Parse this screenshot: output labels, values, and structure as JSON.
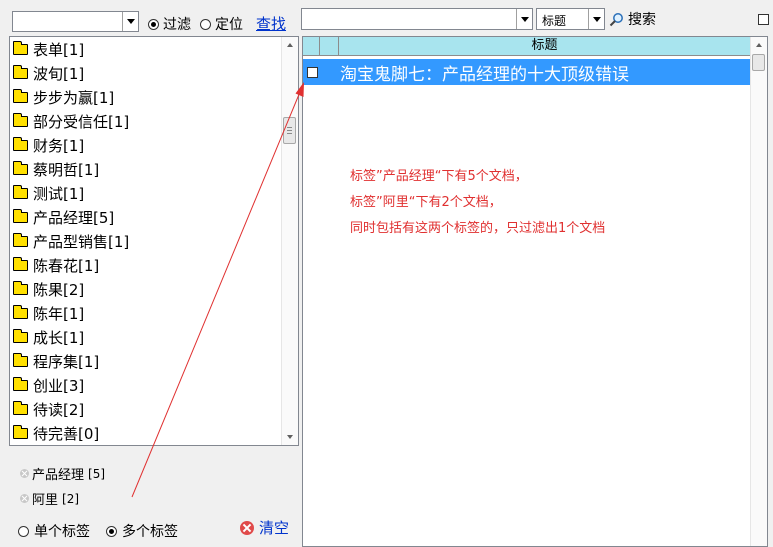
{
  "toolbar_left": {
    "filter_label": "过滤",
    "locate_label": "定位",
    "find_label": "查找",
    "mode_selected": "filter"
  },
  "toolbar_right": {
    "field_select": "标题",
    "search_label": "搜索"
  },
  "tag_tree": {
    "items": [
      {
        "label": "表单[1]"
      },
      {
        "label": "波旬[1]"
      },
      {
        "label": "步步为赢[1]"
      },
      {
        "label": "部分受信任[1]"
      },
      {
        "label": "财务[1]"
      },
      {
        "label": "蔡明哲[1]"
      },
      {
        "label": "测试[1]"
      },
      {
        "label": "产品经理[5]"
      },
      {
        "label": "产品型销售[1]"
      },
      {
        "label": "陈春花[1]"
      },
      {
        "label": "陈果[2]"
      },
      {
        "label": "陈年[1]"
      },
      {
        "label": "成长[1]"
      },
      {
        "label": "程序集[1]"
      },
      {
        "label": "创业[3]"
      },
      {
        "label": "待读[2]"
      },
      {
        "label": "待完善[0]"
      }
    ]
  },
  "selected_tags": [
    {
      "label": "产品经理",
      "count": "[5]"
    },
    {
      "label": "阿里",
      "count": "[2]"
    }
  ],
  "tag_mode": {
    "single_label": "单个标签",
    "multi_label": "多个标签",
    "selected": "multi",
    "clear_label": "清空"
  },
  "doc_list": {
    "column_title": "标题",
    "rows": [
      {
        "title": "淘宝鬼脚七：产品经理的十大顶级错误",
        "selected": true
      }
    ]
  },
  "annotation": {
    "line1": "标签”产品经理“下有5个文档，",
    "line2": "标签”阿里“下有2个文档，",
    "line3": "同时包括有这两个标签的，只过滤出1个文档",
    "color": "#e03030"
  }
}
